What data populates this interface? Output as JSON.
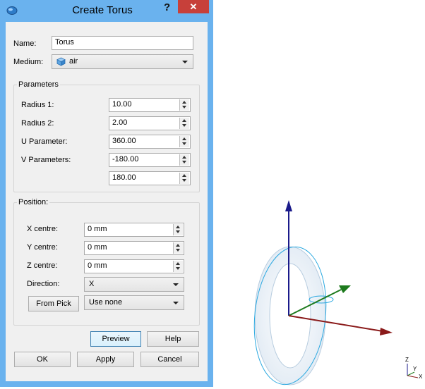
{
  "window": {
    "title": "Create Torus",
    "help_glyph": "?",
    "close_glyph": "✕"
  },
  "form": {
    "name_label": "Name:",
    "name_value": "Torus",
    "medium_label": "Medium:",
    "medium_value": "air"
  },
  "parameters": {
    "title": "Parameters",
    "radius1_label": "Radius 1:",
    "radius1_value": "10.00",
    "radius2_label": "Radius 2:",
    "radius2_value": "2.00",
    "u_label": "U Parameter:",
    "u_value": "360.00",
    "v_label": "V Parameters:",
    "v_value_min": "-180.00",
    "v_value_max": "180.00"
  },
  "position": {
    "title": "Position:",
    "x_label": "X centre:",
    "x_value": "0 mm",
    "y_label": "Y centre:",
    "y_value": "0 mm",
    "z_label": "Z centre:",
    "z_value": "0 mm",
    "direction_label": "Direction:",
    "direction_value": "X",
    "from_pick_label": "From Pick",
    "pick_value": "Use none"
  },
  "buttons": {
    "preview": "Preview",
    "help": "Help",
    "ok": "OK",
    "apply": "Apply",
    "cancel": "Cancel"
  },
  "viewport": {
    "axis_labels": {
      "z": "Z",
      "y": "Y",
      "x": "X"
    },
    "colors": {
      "z_axis": "#1a1a8a",
      "y_axis": "#1d7a1d",
      "x_axis": "#8a1a1a",
      "torus": "#e6eef6",
      "torus_edge": "#2aa8e0"
    }
  }
}
